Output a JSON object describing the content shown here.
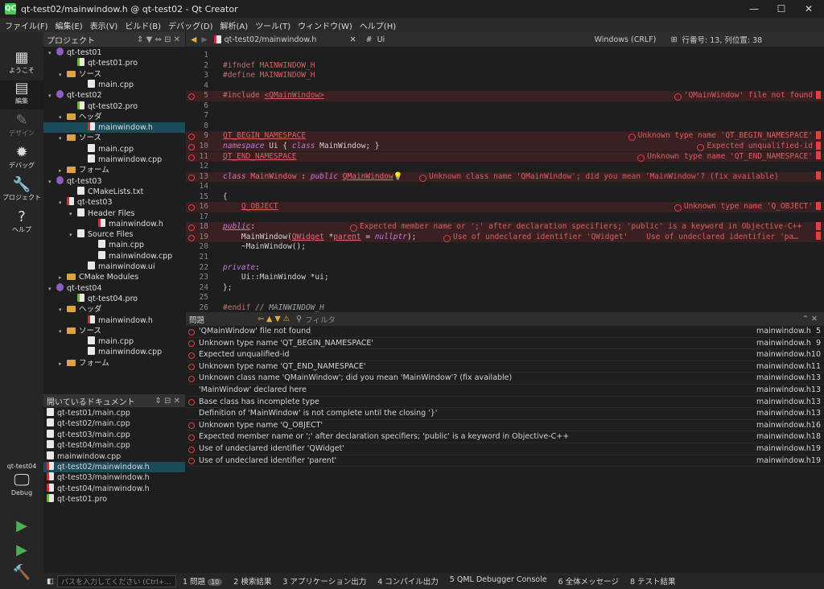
{
  "window": {
    "title": "qt-test02/mainwindow.h @ qt-test02 - Qt Creator",
    "logo": "QC"
  },
  "menu": [
    "ファイル(F)",
    "編集(E)",
    "表示(V)",
    "ビルド(B)",
    "デバッグ(D)",
    "解析(A)",
    "ツール(T)",
    "ウィンドウ(W)",
    "ヘルプ(H)"
  ],
  "modes": [
    {
      "label": "ようこそ",
      "icon": "▦"
    },
    {
      "label": "編集",
      "icon": "▤"
    },
    {
      "label": "デザイン",
      "icon": "✎"
    },
    {
      "label": "デバッグ",
      "icon": "✹"
    },
    {
      "label": "プロジェクト",
      "icon": "🔧"
    },
    {
      "label": "ヘルプ",
      "icon": "?"
    }
  ],
  "kit": {
    "name": "qt-test04",
    "config": "Debug"
  },
  "project_panel": {
    "title": "プロジェクト"
  },
  "tree": [
    {
      "d": 0,
      "t": "qt-test01",
      "k": "proj",
      "a": "▾"
    },
    {
      "d": 2,
      "t": "qt-test01.pro",
      "k": "pro"
    },
    {
      "d": 1,
      "t": "ソース",
      "k": "folder",
      "a": "▾"
    },
    {
      "d": 3,
      "t": "main.cpp",
      "k": "file"
    },
    {
      "d": 0,
      "t": "qt-test02",
      "k": "proj",
      "a": "▾"
    },
    {
      "d": 2,
      "t": "qt-test02.pro",
      "k": "pro"
    },
    {
      "d": 1,
      "t": "ヘッダ",
      "k": "folder",
      "a": "▾"
    },
    {
      "d": 3,
      "t": "mainwindow.h",
      "k": "hdr",
      "sel": true
    },
    {
      "d": 1,
      "t": "ソース",
      "k": "folder",
      "a": "▾"
    },
    {
      "d": 3,
      "t": "main.cpp",
      "k": "file"
    },
    {
      "d": 3,
      "t": "mainwindow.cpp",
      "k": "file"
    },
    {
      "d": 1,
      "t": "フォーム",
      "k": "folder",
      "a": "▸"
    },
    {
      "d": 0,
      "t": "qt-test03",
      "k": "proj",
      "a": "▾"
    },
    {
      "d": 2,
      "t": "CMakeLists.txt",
      "k": "file"
    },
    {
      "d": 1,
      "t": "qt-test03",
      "k": "hdr",
      "a": "▾"
    },
    {
      "d": 2,
      "t": "Header Files",
      "k": "file",
      "a": "▾"
    },
    {
      "d": 4,
      "t": "mainwindow.h",
      "k": "hdr"
    },
    {
      "d": 2,
      "t": "Source Files",
      "k": "file",
      "a": "▾"
    },
    {
      "d": 4,
      "t": "main.cpp",
      "k": "file"
    },
    {
      "d": 4,
      "t": "mainwindow.cpp",
      "k": "file"
    },
    {
      "d": 3,
      "t": "mainwindow.ui",
      "k": "file"
    },
    {
      "d": 1,
      "t": "CMake Modules",
      "k": "folder",
      "a": "▸"
    },
    {
      "d": 0,
      "t": "qt-test04",
      "k": "proj",
      "a": "▾"
    },
    {
      "d": 2,
      "t": "qt-test04.pro",
      "k": "pro"
    },
    {
      "d": 1,
      "t": "ヘッダ",
      "k": "folder",
      "a": "▾"
    },
    {
      "d": 3,
      "t": "mainwindow.h",
      "k": "hdr"
    },
    {
      "d": 1,
      "t": "ソース",
      "k": "folder",
      "a": "▾"
    },
    {
      "d": 3,
      "t": "main.cpp",
      "k": "file"
    },
    {
      "d": 3,
      "t": "mainwindow.cpp",
      "k": "file"
    },
    {
      "d": 1,
      "t": "フォーム",
      "k": "folder",
      "a": "▸"
    }
  ],
  "open_docs": {
    "title": "開いているドキュメント",
    "items": [
      {
        "t": "qt-test01/main.cpp",
        "k": "file"
      },
      {
        "t": "qt-test02/main.cpp",
        "k": "file"
      },
      {
        "t": "qt-test03/main.cpp",
        "k": "file"
      },
      {
        "t": "qt-test04/main.cpp",
        "k": "file"
      },
      {
        "t": "mainwindow.cpp",
        "k": "file"
      },
      {
        "t": "qt-test02/mainwindow.h",
        "k": "hdr",
        "sel": true
      },
      {
        "t": "qt-test03/mainwindow.h",
        "k": "hdr"
      },
      {
        "t": "qt-test04/mainwindow.h",
        "k": "hdr"
      },
      {
        "t": "qt-test01.pro",
        "k": "pro"
      }
    ]
  },
  "editor_toolbar": {
    "file": "qt-test02/mainwindow.h",
    "hash": "#",
    "symbol": "Ui",
    "encoding": "Windows (CRLF)",
    "position": "行番号: 13, 列位置: 38"
  },
  "code": [
    {
      "n": "1",
      "c": ""
    },
    {
      "n": "2",
      "c": "<span class='pp'>#ifndef</span> <span class='mac'>MAINWINDOW_H</span>"
    },
    {
      "n": "3",
      "c": "<span class='pp'>#define</span> <span class='mac'>MAINWINDOW_H</span>"
    },
    {
      "n": "4",
      "c": ""
    },
    {
      "n": "5",
      "c": "<span class='pp'>#include</span> <span class='mac' style='text-decoration:underline'>&lt;QMainWindow&gt;</span>",
      "err": "'QMainWindow' file not found"
    },
    {
      "n": "6",
      "c": ""
    },
    {
      "n": "7",
      "c": ""
    },
    {
      "n": "8",
      "c": ""
    },
    {
      "n": "9",
      "c": "<span class='mac' style='text-decoration:underline'>QT_BEGIN_NAMESPACE</span>",
      "err": "Unknown type name 'QT_BEGIN_NAMESPACE'"
    },
    {
      "n": "10",
      "c": "<span class='kw'>namespace</span> Ui { <span class='kw'>class</span> MainWindow; }",
      "err": "Expected unqualified-id"
    },
    {
      "n": "11",
      "c": "<span class='mac' style='text-decoration:underline'>QT_END_NAMESPACE</span>",
      "err": "Unknown type name 'QT_END_NAMESPACE'"
    },
    {
      "n": "12",
      "c": ""
    },
    {
      "n": "13",
      "c": "<span class='kw'>class</span> <span class='ty'>MainWindow</span> : <span class='kw'>public</span> <span class='ty' style='text-decoration:underline'>QMainWindow</span>💡",
      "err": "Unknown class name 'QMainWindow'; did you mean 'MainWindow'? (fix available)"
    },
    {
      "n": "14",
      "c": ""
    },
    {
      "n": "15",
      "c": "{"
    },
    {
      "n": "16",
      "c": "    <span class='mac' style='text-decoration:underline'>Q_OBJECT</span>",
      "err": "Unknown type name 'Q_OBJECT'"
    },
    {
      "n": "17",
      "c": ""
    },
    {
      "n": "18",
      "c": "<span class='kw' style='text-decoration:underline'>public</span>:",
      "err": "Expected member name or ';' after declaration specifiers; 'public' is a keyword in Objective-C++"
    },
    {
      "n": "19",
      "c": "    MainWindow(<span class='ty' style='text-decoration:underline'>QWidget</span> *<span class='ty' style='text-decoration:underline'>parent</span> = <span class='kw'>nullptr</span>);",
      "err": "Use of undeclared identifier 'QWidget'    Use of undeclared identifier 'pa…"
    },
    {
      "n": "20",
      "c": "    ~MainWindow();"
    },
    {
      "n": "21",
      "c": ""
    },
    {
      "n": "22",
      "c": "<span class='kw'>private</span>:"
    },
    {
      "n": "23",
      "c": "    Ui::MainWindow *ui;"
    },
    {
      "n": "24",
      "c": "};"
    },
    {
      "n": "25",
      "c": ""
    },
    {
      "n": "26",
      "c": "<span class='pp'>#endif</span> <span class='cm'>// MAINWINDOW_H</span>"
    }
  ],
  "issues_panel": {
    "title": "問題",
    "filter_placeholder": "フィルタ"
  },
  "issues": [
    {
      "t": "'QMainWindow' file not found",
      "f": "mainwindow.h",
      "l": "5",
      "e": true
    },
    {
      "t": "Unknown type name 'QT_BEGIN_NAMESPACE'",
      "f": "mainwindow.h",
      "l": "9",
      "e": true
    },
    {
      "t": "Expected unqualified-id",
      "f": "mainwindow.h",
      "l": "10",
      "e": true
    },
    {
      "t": "Unknown type name 'QT_END_NAMESPACE'",
      "f": "mainwindow.h",
      "l": "11",
      "e": true
    },
    {
      "t": "Unknown class name 'QMainWindow'; did you mean 'MainWindow'? (fix available)",
      "f": "mainwindow.h",
      "l": "13",
      "e": true
    },
    {
      "t": "'MainWindow' declared here",
      "f": "mainwindow.h",
      "l": "13",
      "e": false
    },
    {
      "t": "Base class has incomplete type",
      "f": "mainwindow.h",
      "l": "13",
      "e": true
    },
    {
      "t": "Definition of 'MainWindow' is not complete until the closing '}'",
      "f": "mainwindow.h",
      "l": "13",
      "e": false
    },
    {
      "t": "Unknown type name 'Q_OBJECT'",
      "f": "mainwindow.h",
      "l": "16",
      "e": true
    },
    {
      "t": "Expected member name or ';' after declaration specifiers; 'public' is a keyword in Objective-C++",
      "f": "mainwindow.h",
      "l": "18",
      "e": true
    },
    {
      "t": "Use of undeclared identifier 'QWidget'",
      "f": "mainwindow.h",
      "l": "19",
      "e": true
    },
    {
      "t": "Use of undeclared identifier 'parent'",
      "f": "mainwindow.h",
      "l": "19",
      "e": true
    }
  ],
  "statusbar": {
    "search_placeholder": "パスを入力してください (Ctrl+...",
    "tabs": [
      {
        "t": "1 問題",
        "badge": "10"
      },
      {
        "t": "2 検索結果"
      },
      {
        "t": "3 アプリケーション出力"
      },
      {
        "t": "4 コンパイル出力"
      },
      {
        "t": "5 QML Debugger Console"
      },
      {
        "t": "6 全体メッセージ"
      },
      {
        "t": "8 テスト結果"
      }
    ]
  }
}
